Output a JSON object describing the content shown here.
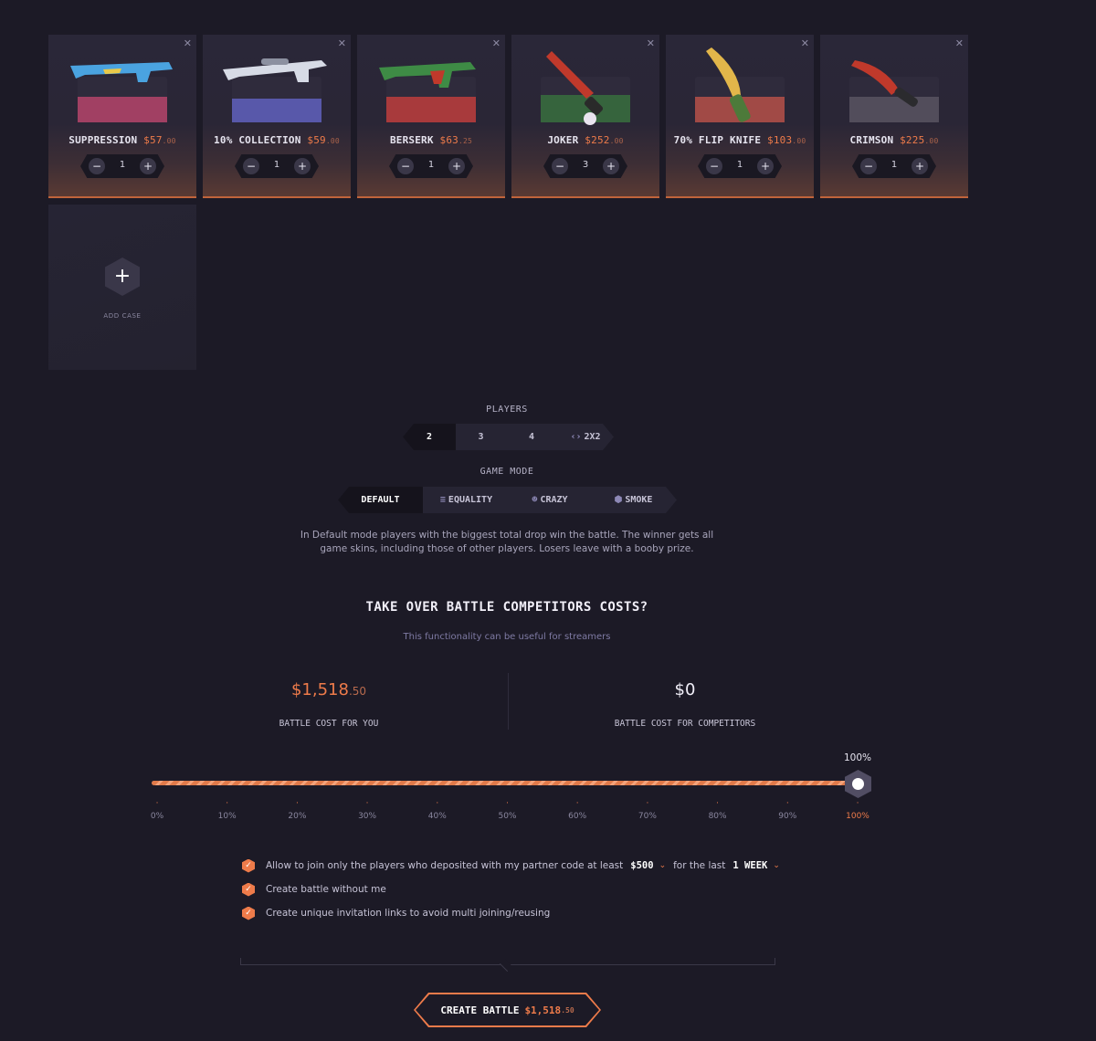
{
  "cases": [
    {
      "name": "SUPPRESSION",
      "price": "$57",
      "cents": ".00",
      "qty": "1",
      "art": "rifle-icon",
      "case_color": "#e94b8b",
      "item_color": "#4aa3e0"
    },
    {
      "name": "10% COLLECTION",
      "price": "$59",
      "cents": ".00",
      "qty": "1",
      "art": "sniper-icon",
      "case_color": "#7c7cf0",
      "item_color": "#d7dbe6"
    },
    {
      "name": "BERSERK",
      "price": "$63",
      "cents": ".25",
      "qty": "1",
      "art": "rifle-icon",
      "case_color": "#e0413f",
      "item_color": "#3e8b45"
    },
    {
      "name": "JOKER",
      "price": "$252",
      "cents": ".00",
      "qty": "3",
      "art": "knife-icon",
      "case_color": "#3c8a3e",
      "item_color": "#c0392b"
    },
    {
      "name": "70% FLIP KNIFE",
      "price": "$103",
      "cents": ".00",
      "qty": "1",
      "art": "knife-icon",
      "case_color": "#d2584a",
      "item_color": "#e2b64a"
    },
    {
      "name": "CRIMSON",
      "price": "$225",
      "cents": ".00",
      "qty": "1",
      "art": "knife-icon",
      "case_color": "#6a6470",
      "item_color": "#c0392b"
    }
  ],
  "add_case": {
    "label": "ADD CASE"
  },
  "players": {
    "label": "PLAYERS",
    "options": [
      "2",
      "3",
      "4",
      "2X2"
    ],
    "selected": "2"
  },
  "game_mode": {
    "label": "GAME MODE",
    "options": [
      "DEFAULT",
      "EQUALITY",
      "CRAZY",
      "SMOKE"
    ],
    "selected": "DEFAULT",
    "description": "In Default mode players with the biggest total drop win the battle. The winner gets all game skins, including those of other players. Losers leave with a booby prize."
  },
  "takeover": {
    "title": "TAKE OVER BATTLE COMPETITORS COSTS?",
    "subtitle": "This functionality can be useful for streamers",
    "you_cost": "$1,518",
    "you_cost_cents": ".50",
    "you_label": "BATTLE COST FOR YOU",
    "comp_cost": "$0",
    "comp_label": "BATTLE COST FOR COMPETITORS"
  },
  "slider": {
    "value_label": "100%",
    "value": 100,
    "ticks": [
      "0%",
      "10%",
      "20%",
      "30%",
      "40%",
      "50%",
      "60%",
      "70%",
      "80%",
      "90%",
      "100%"
    ]
  },
  "options": {
    "opt1_text": "Allow to join only the players who deposited with my partner code at least",
    "opt1_amount": "$500",
    "opt1_mid": "for the last",
    "opt1_period": "1 WEEK",
    "opt2_text": "Create battle without me",
    "opt3_text": "Create unique invitation links to avoid multi joining/reusing"
  },
  "create_button": {
    "label": "CREATE BATTLE",
    "price": "$1,518",
    "cents": ".50"
  },
  "colors": {
    "accent": "#ee7b4a",
    "background": "#1c1a26",
    "card": "#2a2738"
  }
}
